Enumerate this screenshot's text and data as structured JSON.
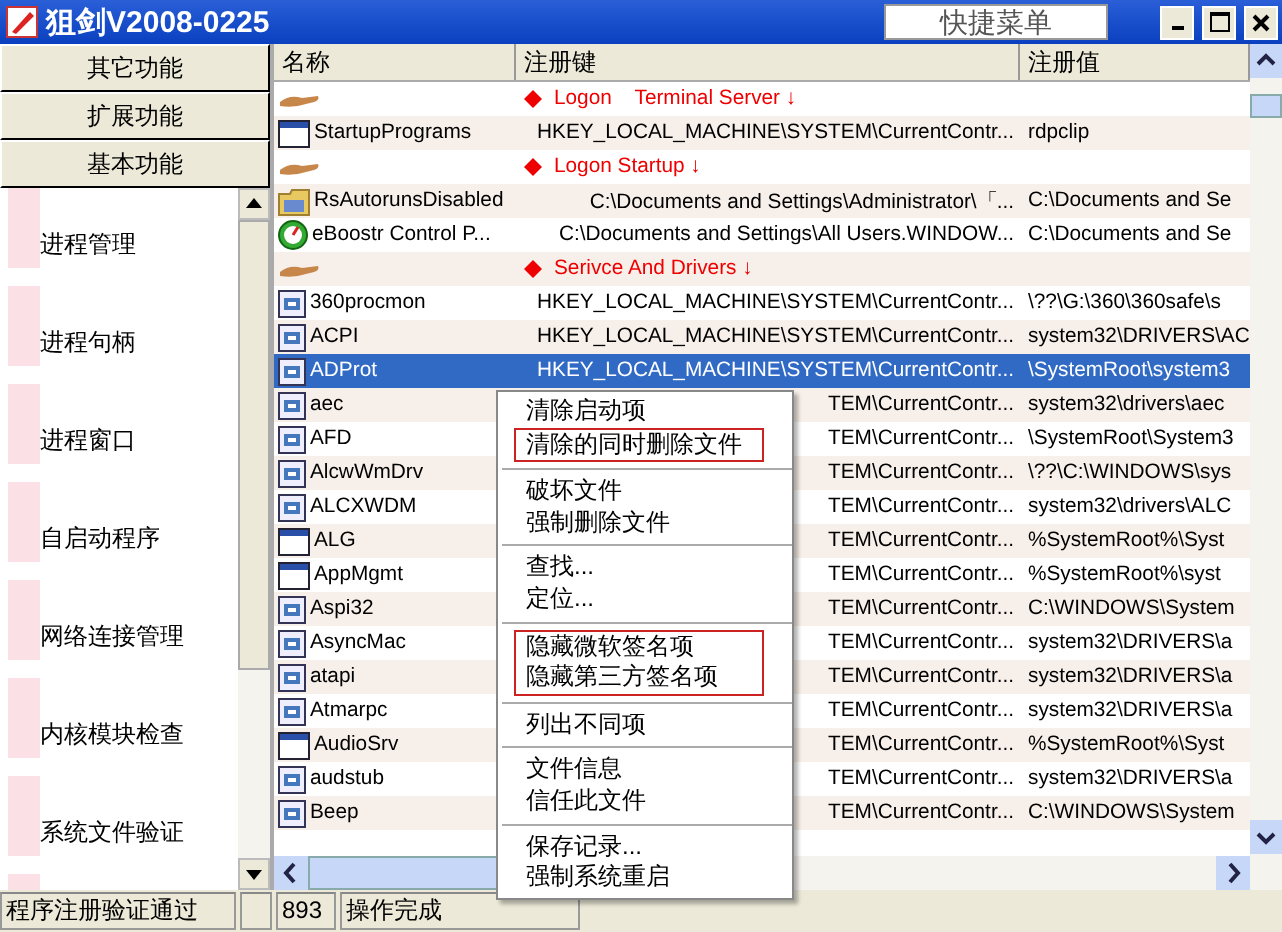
{
  "window": {
    "title": "狙剑V2008-0225",
    "quick_menu": "快捷菜单"
  },
  "sidebar": {
    "buttons": [
      "其它功能",
      "扩展功能",
      "基本功能"
    ],
    "items": [
      "进程管理",
      "进程句柄",
      "进程窗口",
      "自启动程序",
      "网络连接管理",
      "内核模块检查",
      "系统文件验证"
    ]
  },
  "table": {
    "columns": [
      "名称",
      "注册键",
      "注册值"
    ],
    "rows": [
      {
        "kind": "group",
        "title": "Logon    Terminal Server ↓"
      },
      {
        "kind": "service",
        "selected": false,
        "name": "StartupPrograms",
        "key": "HKEY_LOCAL_MACHINE\\SYSTEM\\CurrentContr...",
        "value": "rdpclip"
      },
      {
        "kind": "group",
        "title": "Logon Startup ↓"
      },
      {
        "kind": "folder",
        "selected": false,
        "name": "RsAutorunsDisabled",
        "key": "C:\\Documents and Settings\\Administrator\\「...",
        "value": "C:\\Documents and Se"
      },
      {
        "kind": "app",
        "selected": false,
        "name": "eBoostr Control P...",
        "key": "C:\\Documents and Settings\\All Users.WINDOW...",
        "value": "C:\\Documents and Se"
      },
      {
        "kind": "group",
        "title": "Serivce And Drivers ↓"
      },
      {
        "kind": "driver",
        "selected": false,
        "name": "360procmon",
        "key": "HKEY_LOCAL_MACHINE\\SYSTEM\\CurrentContr...",
        "value": "\\??\\G:\\360\\360safe\\s"
      },
      {
        "kind": "driver",
        "selected": false,
        "name": "ACPI",
        "key": "HKEY_LOCAL_MACHINE\\SYSTEM\\CurrentContr...",
        "value": "system32\\DRIVERS\\AC"
      },
      {
        "kind": "driver",
        "selected": true,
        "name": "ADProt",
        "key": "HKEY_LOCAL_MACHINE\\SYSTEM\\CurrentContr...",
        "value": "\\SystemRoot\\system3"
      },
      {
        "kind": "driver",
        "selected": false,
        "name": "aec",
        "key": "TEM\\CurrentContr...",
        "value": "system32\\drivers\\aec"
      },
      {
        "kind": "driver",
        "selected": false,
        "name": "AFD",
        "key": "TEM\\CurrentContr...",
        "value": "\\SystemRoot\\System3"
      },
      {
        "kind": "driver",
        "selected": false,
        "name": "AlcwWmDrv",
        "key": "TEM\\CurrentContr...",
        "value": "\\??\\C:\\WINDOWS\\sys"
      },
      {
        "kind": "driver",
        "selected": false,
        "name": "ALCXWDM",
        "key": "TEM\\CurrentContr...",
        "value": "system32\\drivers\\ALC"
      },
      {
        "kind": "service",
        "selected": false,
        "name": "ALG",
        "key": "TEM\\CurrentContr...",
        "value": "%SystemRoot%\\Syst"
      },
      {
        "kind": "service",
        "selected": false,
        "name": "AppMgmt",
        "key": "TEM\\CurrentContr...",
        "value": "%SystemRoot%\\syst"
      },
      {
        "kind": "driver",
        "selected": false,
        "name": "Aspi32",
        "key": "TEM\\CurrentContr...",
        "value": "C:\\WINDOWS\\System"
      },
      {
        "kind": "driver",
        "selected": false,
        "name": "AsyncMac",
        "key": "TEM\\CurrentContr...",
        "value": "system32\\DRIVERS\\a"
      },
      {
        "kind": "driver",
        "selected": false,
        "name": "atapi",
        "key": "TEM\\CurrentContr...",
        "value": "system32\\DRIVERS\\a"
      },
      {
        "kind": "driver",
        "selected": false,
        "name": "Atmarpc",
        "key": "TEM\\CurrentContr...",
        "value": "system32\\DRIVERS\\a"
      },
      {
        "kind": "service",
        "selected": false,
        "name": "AudioSrv",
        "key": "TEM\\CurrentContr...",
        "value": "%SystemRoot%\\Syst"
      },
      {
        "kind": "driver",
        "selected": false,
        "name": "audstub",
        "key": "TEM\\CurrentContr...",
        "value": "system32\\DRIVERS\\a"
      },
      {
        "kind": "driver",
        "selected": false,
        "name": "Beep",
        "key": "TEM\\CurrentContr...",
        "value": "C:\\WINDOWS\\System"
      }
    ]
  },
  "context_menu": [
    [
      {
        "label": "清除启动项",
        "marked": false
      },
      {
        "label": "清除的同时删除文件",
        "marked": true
      }
    ],
    [
      {
        "label": "破坏文件",
        "marked": false
      },
      {
        "label": "强制删除文件",
        "marked": false
      }
    ],
    [
      {
        "label": "查找...",
        "marked": false
      },
      {
        "label": "定位...",
        "marked": false
      }
    ],
    [
      {
        "label": "隐藏微软签名项",
        "marked": true
      },
      {
        "label": "隐藏第三方签名项",
        "marked": true
      }
    ],
    [
      {
        "label": "列出不同项",
        "marked": false
      }
    ],
    [
      {
        "label": "文件信息",
        "marked": false
      },
      {
        "label": "信任此文件",
        "marked": false
      }
    ],
    [
      {
        "label": "保存记录...",
        "marked": false
      },
      {
        "label": "强制系统重启",
        "marked": false
      }
    ]
  ],
  "status_bar": [
    "程序注册验证通过",
    "893",
    "操作完成"
  ]
}
